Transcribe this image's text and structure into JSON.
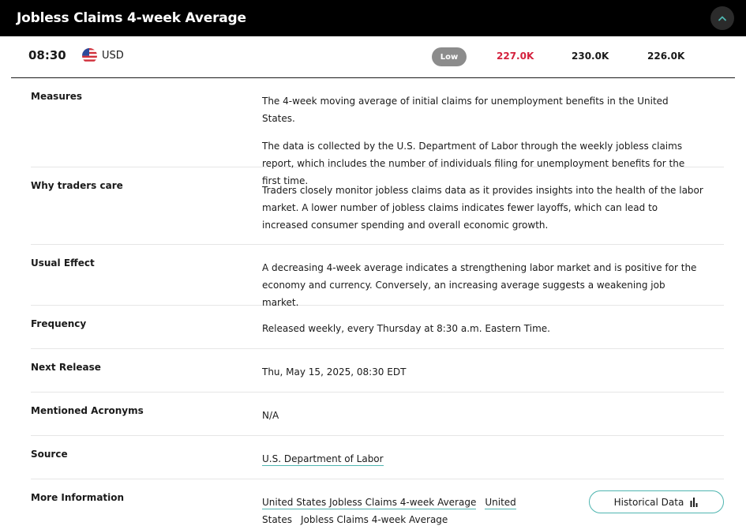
{
  "header": {
    "title": "Jobless Claims 4-week Average"
  },
  "event": {
    "time": "08:30",
    "currency": "USD",
    "impact": "Low",
    "actual": "227.0K",
    "forecast": "230.0K",
    "previous": "226.0K"
  },
  "colors": {
    "actual": "#d4213d",
    "accent": "#4fb5b0",
    "header_bg": "#000000",
    "impact_badge": "#8c8c8c"
  },
  "details": {
    "measures": {
      "label": "Measures",
      "p1": "The 4-week moving average of initial claims for unemployment benefits in the United States.",
      "p2": "The data is collected by the U.S. Department of Labor through the weekly jobless claims report, which includes the number of individuals filing for unemployment benefits for the first time."
    },
    "why": {
      "label": "Why traders care",
      "text": "Traders closely monitor jobless claims data as it provides insights into the health of the labor market. A lower number of jobless claims indicates fewer layoffs, which can lead to increased consumer spending and overall economic growth."
    },
    "effect": {
      "label": "Usual Effect",
      "text": "A decreasing 4-week average indicates a strengthening labor market and is positive for the economy and currency. Conversely, an increasing average suggests a weakening job market."
    },
    "frequency": {
      "label": "Frequency",
      "text": "Released weekly, every Thursday at 8:30 a.m. Eastern Time."
    },
    "next_release": {
      "label": "Next Release",
      "text": "Thu, May 15, 2025, 08:30 EDT"
    },
    "acronyms": {
      "label": "Mentioned Acronyms",
      "text": "N/A"
    },
    "source": {
      "label": "Source",
      "link": "U.S. Department of Labor"
    },
    "more_info": {
      "label": "More Information",
      "links": [
        "United States Jobless Claims 4-week Average",
        "United States",
        "Jobless Claims 4-week Average"
      ],
      "historical_button": "Historical Data"
    }
  },
  "icons": {
    "collapse": "chevron-up-icon",
    "flag": "us-flag-icon",
    "chart": "bar-chart-icon"
  }
}
